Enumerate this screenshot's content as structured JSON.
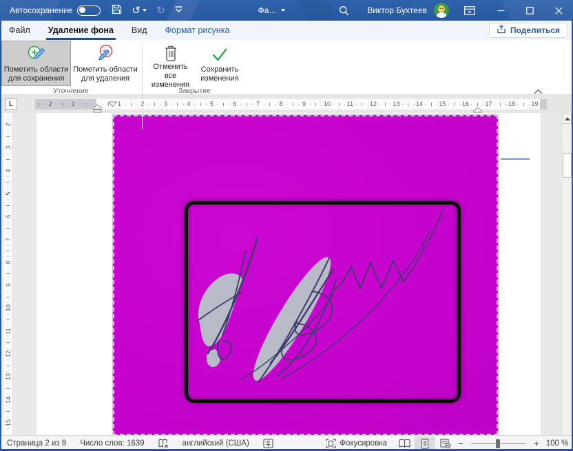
{
  "titlebar": {
    "autosave_label": "Автосохранение",
    "autosave_state": "off",
    "document_name": "Фа...",
    "user_name": "Виктор Бухтеев"
  },
  "tabs": {
    "file": "Файл",
    "background_removal": "Удаление фона",
    "view": "Вид",
    "picture_format": "Формат рисунка",
    "share_button": "Поделиться"
  },
  "ribbon": {
    "mark_keep": {
      "line1": "Пометить области",
      "line2": "для сохранения"
    },
    "mark_remove": {
      "line1": "Пометить области",
      "line2": "для удаления"
    },
    "discard": {
      "line1": "Отменить все",
      "line2": "изменения"
    },
    "keep_changes": {
      "line1": "Сохранить",
      "line2": "изменения"
    },
    "group_refine": "Уточнение",
    "group_close": "Закрытие"
  },
  "ruler": {
    "tab_selector": "L",
    "h_margin_numbers": [
      "2",
      "1"
    ],
    "h_numbers": [
      "1",
      "2",
      "3",
      "4",
      "5",
      "6",
      "7",
      "8",
      "9",
      "10",
      "11",
      "12",
      "13",
      "14",
      "15",
      "16",
      "17",
      "18",
      "19"
    ],
    "v_numbers": [
      "2",
      "3",
      "4",
      "5",
      "6",
      "7",
      "8",
      "9",
      "10",
      "11",
      "12",
      "13",
      "14",
      "15"
    ]
  },
  "statusbar": {
    "page_info": "Страница 2 из 9",
    "word_count": "Число слов: 1639",
    "language": "английский (США)",
    "focus_label": "Фокусировка",
    "zoom_level": "100 %"
  },
  "colors": {
    "titlebar_blue": "#2b5da6",
    "accent_blue": "#2b579a",
    "removal_overlay_magenta": "#c603cd",
    "keep_region_gray": "#b9bcc8",
    "signature_ink": "#3c3c6a"
  }
}
